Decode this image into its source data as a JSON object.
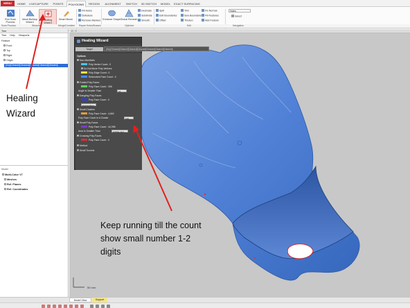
{
  "menu_label": "MENU",
  "tabs": [
    "HOME",
    "LIVECAPTURE",
    "POINTS",
    "POLYGONS",
    "REGION",
    "ALIGNMENT",
    "SKETCH",
    "3D SKETCH",
    "MODEL",
    "EXACT SURFACING"
  ],
  "active_tab": "POLYGONS",
  "ribbon": {
    "run_scan_process": "Run Scan Process",
    "mesh_buildup_wizard": "Mesh Buildup Wizard",
    "healing_wizard": "Healing Wizard",
    "smart_brush": "Smart Brush",
    "fill_holes": "Fill Holes",
    "defeature": "Defeature",
    "remove_markers": "Remove Markers",
    "enhance_shape": "Enhance Shape",
    "global_remesh": "Global Remesh",
    "decimate": "Decimate",
    "subdivide": "Subdivide",
    "smooth": "Smooth",
    "split": "Split",
    "edit_boundaries": "Edit Boundaries",
    "offset": "Offset",
    "trim": "Trim",
    "sew_boundaries": "Sew Boundaries",
    "thicken": "Thicken",
    "fix_normal": "Fix Normal",
    "fill_features": "Fill Features",
    "add_feature": "Add Feature",
    "select_combo": "Holes",
    "select_label": "Select",
    "groups": [
      "Scan Process",
      "Wizards",
      "Merge/Combine",
      "Repair Holes/Bosses",
      "Optimize",
      "Edit",
      "Navigation"
    ]
  },
  "left_panel": {
    "title": "Tree",
    "toolbar": [
      "Tree",
      "Help",
      "Viewports"
    ],
    "feature_header": "Feature",
    "items": [
      "Front",
      "Top",
      "Right",
      "Origin"
    ],
    "selected_item": "[Grp]Cleaned]Cleaned]Cleaned]Cleaned]Cleaned]",
    "model_title": "Model",
    "model_items": [
      "Multi-Color V7",
      "Meshes",
      "Ref. Planes",
      "Ref. Coordinates"
    ]
  },
  "viewport": {
    "top_text": "Z ↑  Y"
  },
  "wizard": {
    "title": "Healing Wizard",
    "target_label": "Target",
    "target_value": "[Grp]Cleaned]Cleaned]Cleaned]Cleaned]Cleaned]Cleaned]Cleaned]",
    "options_header": "Options",
    "non_manifolds": "Non-Manifolds",
    "poly_vertex_count": "Poly-Vertex Count :",
    "poly_vertex_value": "0",
    "do_not_move": "Do Not Move Poly-Vertices",
    "poly_edge_count": "Poly-Edge Count :",
    "poly_edge_value": "0",
    "redundant_face_count": "Redundant Face Count :",
    "redundant_face_value": "0",
    "folded_faces": "Folded Poly-Faces",
    "folded_count": "Poly-Face Count :",
    "folded_value": "306",
    "angle_smaller": "Angle Is Smaller Than",
    "angle_value": "15",
    "dangling_faces": "Dangling Poly-Faces",
    "dangling_count": "Poly-Face Count :",
    "dangling_value": "0",
    "dangling_field": "3 (cm) Open",
    "small_clusters": "Small Clusters",
    "clusters_count": "Poly-Face Count :",
    "clusters_value": "4,660",
    "in_cluster": "Poly-Face Count In A Cluster",
    "in_cluster_value": "100",
    "small_faces": "Small Poly-Faces",
    "small_count": "Poly-Face Count :",
    "small_value": "44,398",
    "area_smaller": "Area Is Smaller Than",
    "area_value": "0.0001 mm²",
    "crossing_faces": "Crossing Poly-Faces",
    "crossing_count": "Poly-Face Count :",
    "crossing_value": "0",
    "method": "Method",
    "small_tunnels": "Small Tunnels"
  },
  "annotations": {
    "healing_wizard_1": "Healing",
    "healing_wizard_2": "Wizard",
    "keep_running_1": "Keep running till the count",
    "keep_running_2": "show small number 1-2",
    "keep_running_3": "digits"
  },
  "status": {
    "tabs": [
      "Model View",
      "Support"
    ],
    "scale_label": "50 mm"
  },
  "colors": {
    "accent": "#c8282c",
    "mesh_fill": "#4d7fd6",
    "viewport_bg": "#c8c8c8",
    "arrow": "#e02020",
    "wizard_bg": "#444444"
  }
}
